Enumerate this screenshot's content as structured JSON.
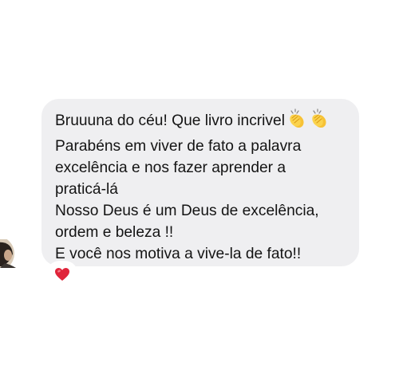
{
  "message": {
    "lines": [
      "Bruuuna do céu! Que livro incrivel",
      "Parabéns em viver de fato a palavra",
      "excelência e nos fazer aprender a",
      "praticá-lá",
      "Nosso Deus é um Deus de excelência,",
      "ordem e beleza !!",
      "E você nos motiva a vive-la de fato!!"
    ],
    "trailing_emoji": [
      "clapping-hands",
      "clapping-hands"
    ]
  },
  "reaction": {
    "emoji": "red-heart"
  },
  "colors": {
    "bubble": "#efeff1",
    "text": "#141414",
    "heart": "#e0243a",
    "clap": "#f7c236"
  }
}
